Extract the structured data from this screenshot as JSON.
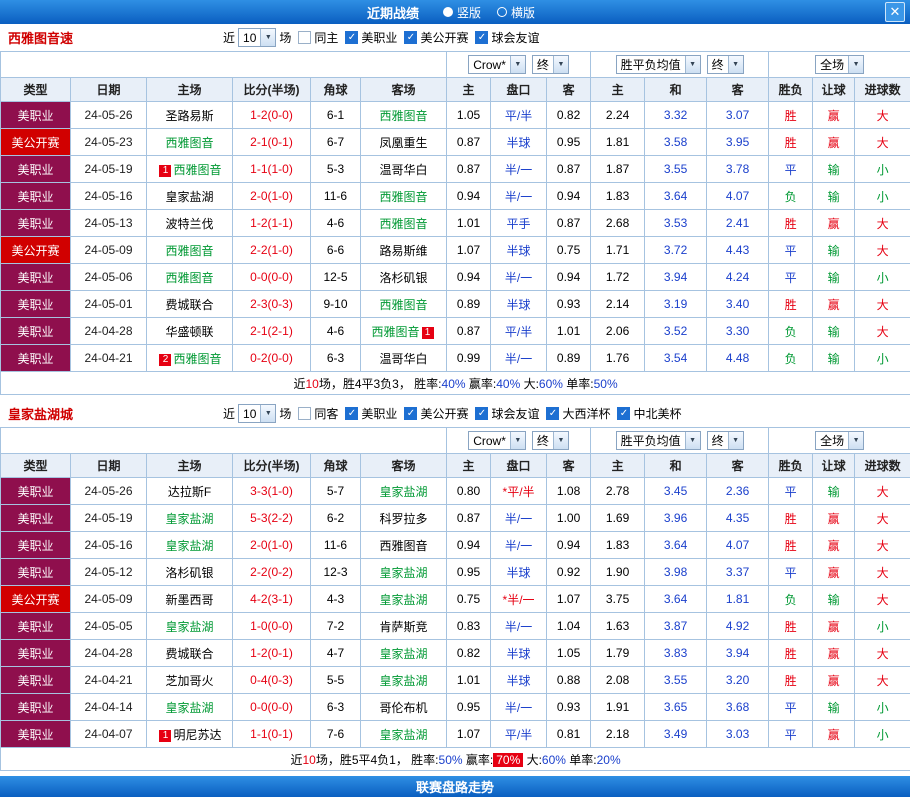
{
  "topbar": {
    "title": "近期战绩",
    "radios": [
      {
        "label": "竖版",
        "selected": true
      },
      {
        "label": "横版",
        "selected": false
      }
    ],
    "close_icon": "✕"
  },
  "bottombar": {
    "title": "联赛盘路走势"
  },
  "palette": {
    "topbar_blue": "#0a5ec0",
    "league_mls": "#8f0f4d",
    "league_open": "#d10000",
    "red": "#e60012",
    "green": "#009933",
    "blue": "#1a3fcc",
    "team_green": "#009933",
    "grid_line": "#a6c3e0",
    "header_bg": "#e8eff8"
  },
  "sections": [
    {
      "team": "西雅图音速",
      "filter": {
        "near": "近",
        "count": "10",
        "unit": "场",
        "checkboxes": [
          {
            "label": "同主",
            "checked": false
          },
          {
            "label": "美职业",
            "checked": true
          },
          {
            "label": "美公开赛",
            "checked": true
          },
          {
            "label": "球会友谊",
            "checked": true
          }
        ]
      },
      "selects": [
        {
          "name": "odds-company-select",
          "value": "Crow*"
        },
        {
          "name": "asian-final-select",
          "value": "终"
        },
        {
          "name": "europe-odds-select",
          "value": "胜平负均值"
        },
        {
          "name": "europe-final-select",
          "value": "终"
        },
        {
          "name": "scope-select",
          "value": "全场"
        }
      ],
      "headers": [
        "类型",
        "日期",
        "主场",
        "比分(半场)",
        "角球",
        "客场",
        "主",
        "盘口",
        "客",
        "主",
        "和",
        "客",
        "胜负",
        "让球",
        "进球数"
      ],
      "rows": [
        {
          "league": "美职业",
          "league_style": "mls",
          "date": "24-05-26",
          "home": "圣路易斯",
          "home_focus": false,
          "score": "1-2(0-0)",
          "corner": "6-1",
          "away": "西雅图音",
          "away_focus": true,
          "ah": "1.05",
          "hc": "平/半",
          "aa": "0.82",
          "eh": "2.24",
          "ed": "3.32",
          "ea": "3.07",
          "res": "胜",
          "res_s": "win",
          "cov": "赢",
          "cov_s": "win",
          "goal": "大",
          "goal_s": "over"
        },
        {
          "league": "美公开赛",
          "league_style": "open",
          "date": "24-05-23",
          "home": "西雅图音",
          "home_focus": true,
          "score": "2-1(0-1)",
          "corner": "6-7",
          "away": "凤凰重生",
          "away_focus": false,
          "ah": "0.87",
          "hc": "半球",
          "aa": "0.95",
          "eh": "1.81",
          "ed": "3.58",
          "ea": "3.95",
          "res": "胜",
          "res_s": "win",
          "cov": "赢",
          "cov_s": "win",
          "goal": "大",
          "goal_s": "over"
        },
        {
          "league": "美职业",
          "league_style": "mls",
          "date": "24-05-19",
          "home": "西雅图音",
          "home_focus": true,
          "home_badge": {
            "n": "1",
            "pos": "pre"
          },
          "score": "1-1(1-0)",
          "corner": "5-3",
          "away": "温哥华白",
          "away_focus": false,
          "ah": "0.87",
          "hc": "半/一",
          "aa": "0.87",
          "eh": "1.87",
          "ed": "3.55",
          "ea": "3.78",
          "res": "平",
          "res_s": "draw",
          "cov": "输",
          "cov_s": "lose",
          "goal": "小",
          "goal_s": "under"
        },
        {
          "league": "美职业",
          "league_style": "mls",
          "date": "24-05-16",
          "home": "皇家盐湖",
          "home_focus": false,
          "score": "2-0(1-0)",
          "corner": "11-6",
          "away": "西雅图音",
          "away_focus": true,
          "ah": "0.94",
          "hc": "半/一",
          "aa": "0.94",
          "eh": "1.83",
          "ed": "3.64",
          "ea": "4.07",
          "res": "负",
          "res_s": "lose",
          "cov": "输",
          "cov_s": "lose",
          "goal": "小",
          "goal_s": "under"
        },
        {
          "league": "美职业",
          "league_style": "mls",
          "date": "24-05-13",
          "home": "波特兰伐",
          "home_focus": false,
          "score": "1-2(1-1)",
          "corner": "4-6",
          "away": "西雅图音",
          "away_focus": true,
          "ah": "1.01",
          "hc": "平手",
          "aa": "0.87",
          "eh": "2.68",
          "ed": "3.53",
          "ea": "2.41",
          "res": "胜",
          "res_s": "win",
          "cov": "赢",
          "cov_s": "win",
          "goal": "大",
          "goal_s": "over"
        },
        {
          "league": "美公开赛",
          "league_style": "open",
          "date": "24-05-09",
          "home": "西雅图音",
          "home_focus": true,
          "score": "2-2(1-0)",
          "corner": "6-6",
          "away": "路易斯维",
          "away_focus": false,
          "ah": "1.07",
          "hc": "半球",
          "aa": "0.75",
          "eh": "1.71",
          "ed": "3.72",
          "ea": "4.43",
          "res": "平",
          "res_s": "draw",
          "cov": "输",
          "cov_s": "lose",
          "goal": "大",
          "goal_s": "over"
        },
        {
          "league": "美职业",
          "league_style": "mls",
          "date": "24-05-06",
          "home": "西雅图音",
          "home_focus": true,
          "score": "0-0(0-0)",
          "corner": "12-5",
          "away": "洛杉矶银",
          "away_focus": false,
          "ah": "0.94",
          "hc": "半/一",
          "aa": "0.94",
          "eh": "1.72",
          "ed": "3.94",
          "ea": "4.24",
          "res": "平",
          "res_s": "draw",
          "cov": "输",
          "cov_s": "lose",
          "goal": "小",
          "goal_s": "under"
        },
        {
          "league": "美职业",
          "league_style": "mls",
          "date": "24-05-01",
          "home": "费城联合",
          "home_focus": false,
          "score": "2-3(0-3)",
          "corner": "9-10",
          "away": "西雅图音",
          "away_focus": true,
          "ah": "0.89",
          "hc": "半球",
          "aa": "0.93",
          "eh": "2.14",
          "ed": "3.19",
          "ea": "3.40",
          "res": "胜",
          "res_s": "win",
          "cov": "赢",
          "cov_s": "win",
          "goal": "大",
          "goal_s": "over"
        },
        {
          "league": "美职业",
          "league_style": "mls",
          "date": "24-04-28",
          "home": "华盛顿联",
          "home_focus": false,
          "score": "2-1(2-1)",
          "corner": "4-6",
          "away": "西雅图音",
          "away_focus": true,
          "away_badge": {
            "n": "1",
            "pos": "post"
          },
          "ah": "0.87",
          "hc": "平/半",
          "aa": "1.01",
          "eh": "2.06",
          "ed": "3.52",
          "ea": "3.30",
          "res": "负",
          "res_s": "lose",
          "cov": "输",
          "cov_s": "lose",
          "goal": "大",
          "goal_s": "over"
        },
        {
          "league": "美职业",
          "league_style": "mls",
          "date": "24-04-21",
          "home": "西雅图音",
          "home_focus": true,
          "home_badge": {
            "n": "2",
            "pos": "pre"
          },
          "score": "0-2(0-0)",
          "corner": "6-3",
          "away": "温哥华白",
          "away_focus": false,
          "ah": "0.99",
          "hc": "半/一",
          "aa": "0.89",
          "eh": "1.76",
          "ed": "3.54",
          "ea": "4.48",
          "res": "负",
          "res_s": "lose",
          "cov": "输",
          "cov_s": "lose",
          "goal": "小",
          "goal_s": "under"
        }
      ],
      "summary": [
        {
          "t": "近"
        },
        {
          "t": "10",
          "c": "num-red"
        },
        {
          "t": "场，胜4平3负3， 胜率:"
        },
        {
          "t": "40%",
          "c": "val-blue"
        },
        {
          "t": " 赢率:"
        },
        {
          "t": "40%",
          "c": "val-blue"
        },
        {
          "t": " 大:"
        },
        {
          "t": "60%",
          "c": "val-blue"
        },
        {
          "t": " 单率:"
        },
        {
          "t": "50%",
          "c": "val-blue"
        }
      ]
    },
    {
      "team": "皇家盐湖城",
      "filter": {
        "near": "近",
        "count": "10",
        "unit": "场",
        "checkboxes": [
          {
            "label": "同客",
            "checked": false
          },
          {
            "label": "美职业",
            "checked": true
          },
          {
            "label": "美公开赛",
            "checked": true
          },
          {
            "label": "球会友谊",
            "checked": true
          },
          {
            "label": "大西洋杯",
            "checked": true
          },
          {
            "label": "中北美杯",
            "checked": true
          }
        ]
      },
      "selects": [
        {
          "name": "odds-company-select",
          "value": "Crow*"
        },
        {
          "name": "asian-final-select",
          "value": "终"
        },
        {
          "name": "europe-odds-select",
          "value": "胜平负均值"
        },
        {
          "name": "europe-final-select",
          "value": "终"
        },
        {
          "name": "scope-select",
          "value": "全场"
        }
      ],
      "headers": [
        "类型",
        "日期",
        "主场",
        "比分(半场)",
        "角球",
        "客场",
        "主",
        "盘口",
        "客",
        "主",
        "和",
        "客",
        "胜负",
        "让球",
        "进球数"
      ],
      "rows": [
        {
          "league": "美职业",
          "league_style": "mls",
          "date": "24-05-26",
          "home": "达拉斯F",
          "home_focus": false,
          "score": "3-3(1-0)",
          "corner": "5-7",
          "away": "皇家盐湖",
          "away_focus": true,
          "ah": "0.80",
          "hc": "平/半",
          "hc_star": true,
          "aa": "1.08",
          "eh": "2.78",
          "ed": "3.45",
          "ea": "2.36",
          "res": "平",
          "res_s": "draw",
          "cov": "输",
          "cov_s": "lose",
          "goal": "大",
          "goal_s": "over"
        },
        {
          "league": "美职业",
          "league_style": "mls",
          "date": "24-05-19",
          "home": "皇家盐湖",
          "home_focus": true,
          "score": "5-3(2-2)",
          "corner": "6-2",
          "away": "科罗拉多",
          "away_focus": false,
          "ah": "0.87",
          "hc": "半/一",
          "aa": "1.00",
          "eh": "1.69",
          "ed": "3.96",
          "ea": "4.35",
          "res": "胜",
          "res_s": "win",
          "cov": "赢",
          "cov_s": "win",
          "goal": "大",
          "goal_s": "over"
        },
        {
          "league": "美职业",
          "league_style": "mls",
          "date": "24-05-16",
          "home": "皇家盐湖",
          "home_focus": true,
          "score": "2-0(1-0)",
          "corner": "11-6",
          "away": "西雅图音",
          "away_focus": false,
          "ah": "0.94",
          "hc": "半/一",
          "aa": "0.94",
          "eh": "1.83",
          "ed": "3.64",
          "ea": "4.07",
          "res": "胜",
          "res_s": "win",
          "cov": "赢",
          "cov_s": "win",
          "goal": "大",
          "goal_s": "over"
        },
        {
          "league": "美职业",
          "league_style": "mls",
          "date": "24-05-12",
          "home": "洛杉矶银",
          "home_focus": false,
          "score": "2-2(0-2)",
          "corner": "12-3",
          "away": "皇家盐湖",
          "away_focus": true,
          "ah": "0.95",
          "hc": "半球",
          "aa": "0.92",
          "eh": "1.90",
          "ed": "3.98",
          "ea": "3.37",
          "res": "平",
          "res_s": "draw",
          "cov": "赢",
          "cov_s": "win",
          "goal": "大",
          "goal_s": "over"
        },
        {
          "league": "美公开赛",
          "league_style": "open",
          "date": "24-05-09",
          "home": "新墨西哥",
          "home_focus": false,
          "score": "4-2(3-1)",
          "corner": "4-3",
          "away": "皇家盐湖",
          "away_focus": true,
          "ah": "0.75",
          "hc": "半/一",
          "hc_star": true,
          "aa": "1.07",
          "eh": "3.75",
          "ed": "3.64",
          "ea": "1.81",
          "res": "负",
          "res_s": "lose",
          "cov": "输",
          "cov_s": "lose",
          "goal": "大",
          "goal_s": "over"
        },
        {
          "league": "美职业",
          "league_style": "mls",
          "date": "24-05-05",
          "home": "皇家盐湖",
          "home_focus": true,
          "score": "1-0(0-0)",
          "corner": "7-2",
          "away": "肯萨斯竞",
          "away_focus": false,
          "ah": "0.83",
          "hc": "半/一",
          "aa": "1.04",
          "eh": "1.63",
          "ed": "3.87",
          "ea": "4.92",
          "res": "胜",
          "res_s": "win",
          "cov": "赢",
          "cov_s": "win",
          "goal": "小",
          "goal_s": "under"
        },
        {
          "league": "美职业",
          "league_style": "mls",
          "date": "24-04-28",
          "home": "费城联合",
          "home_focus": false,
          "score": "1-2(0-1)",
          "corner": "4-7",
          "away": "皇家盐湖",
          "away_focus": true,
          "ah": "0.82",
          "hc": "半球",
          "aa": "1.05",
          "eh": "1.79",
          "ed": "3.83",
          "ea": "3.94",
          "res": "胜",
          "res_s": "win",
          "cov": "赢",
          "cov_s": "win",
          "goal": "大",
          "goal_s": "over"
        },
        {
          "league": "美职业",
          "league_style": "mls",
          "date": "24-04-21",
          "home": "芝加哥火",
          "home_focus": false,
          "score": "0-4(0-3)",
          "corner": "5-5",
          "away": "皇家盐湖",
          "away_focus": true,
          "ah": "1.01",
          "hc": "半球",
          "aa": "0.88",
          "eh": "2.08",
          "ed": "3.55",
          "ea": "3.20",
          "res": "胜",
          "res_s": "win",
          "cov": "赢",
          "cov_s": "win",
          "goal": "大",
          "goal_s": "over"
        },
        {
          "league": "美职业",
          "league_style": "mls",
          "date": "24-04-14",
          "home": "皇家盐湖",
          "home_focus": true,
          "score": "0-0(0-0)",
          "corner": "6-3",
          "away": "哥伦布机",
          "away_focus": false,
          "ah": "0.95",
          "hc": "半/一",
          "aa": "0.93",
          "eh": "1.91",
          "ed": "3.65",
          "ea": "3.68",
          "res": "平",
          "res_s": "draw",
          "cov": "输",
          "cov_s": "lose",
          "goal": "小",
          "goal_s": "under"
        },
        {
          "league": "美职业",
          "league_style": "mls",
          "date": "24-04-07",
          "home": "明尼苏达",
          "home_focus": false,
          "home_badge": {
            "n": "1",
            "pos": "pre"
          },
          "score": "1-1(0-1)",
          "corner": "7-6",
          "away": "皇家盐湖",
          "away_focus": true,
          "ah": "1.07",
          "hc": "平/半",
          "aa": "0.81",
          "eh": "2.18",
          "ed": "3.49",
          "ea": "3.03",
          "res": "平",
          "res_s": "draw",
          "cov": "赢",
          "cov_s": "win",
          "goal": "小",
          "goal_s": "under"
        }
      ],
      "summary": [
        {
          "t": "近"
        },
        {
          "t": "10",
          "c": "num-red"
        },
        {
          "t": "场，胜5平4负1， 胜率:"
        },
        {
          "t": "50%",
          "c": "val-blue"
        },
        {
          "t": " 赢率:"
        },
        {
          "t": "70%",
          "c": "val-redbox"
        },
        {
          "t": " 大:"
        },
        {
          "t": "60%",
          "c": "val-blue"
        },
        {
          "t": " 单率:"
        },
        {
          "t": "20%",
          "c": "val-blue"
        }
      ]
    }
  ]
}
